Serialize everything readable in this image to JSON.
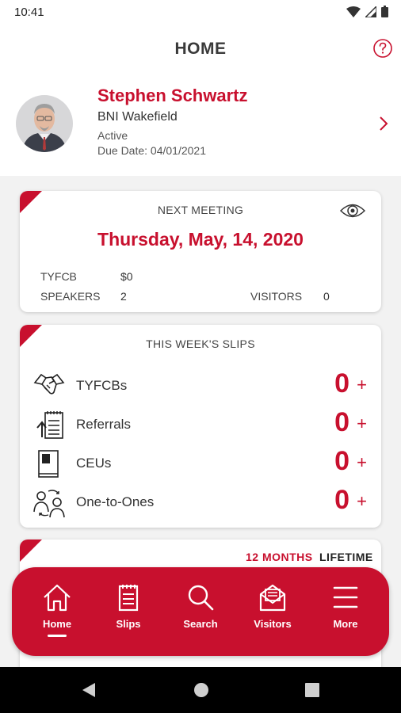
{
  "status_bar": {
    "time": "10:41"
  },
  "header": {
    "title": "HOME"
  },
  "profile": {
    "name": "Stephen Schwartz",
    "chapter": "BNI Wakefield",
    "status": "Active",
    "due_date": "Due Date: 04/01/2021"
  },
  "next_meeting": {
    "heading": "NEXT MEETING",
    "date": "Thursday, May, 14, 2020",
    "tyfcb_label": "TYFCB",
    "tyfcb_value": "$0",
    "speakers_label": "SPEAKERS",
    "speakers_value": "2",
    "visitors_label": "VISITORS",
    "visitors_value": "0"
  },
  "slips": {
    "heading": "THIS WEEK'S SLIPS",
    "items": [
      {
        "label": "TYFCBs",
        "count": "0",
        "plus": "+",
        "icon": "handshake-icon"
      },
      {
        "label": "Referrals",
        "count": "0",
        "plus": "+",
        "icon": "referral-list-icon"
      },
      {
        "label": "CEUs",
        "count": "0",
        "plus": "+",
        "icon": "book-icon"
      },
      {
        "label": "One-to-Ones",
        "count": "0",
        "plus": "+",
        "icon": "people-exchange-icon"
      }
    ]
  },
  "stats": {
    "tab_12_months": "12 MONTHS",
    "tab_lifetime": "LIFETIME"
  },
  "bottom_nav": [
    {
      "label": "Home",
      "icon": "home-icon",
      "active": true
    },
    {
      "label": "Slips",
      "icon": "notepad-icon"
    },
    {
      "label": "Search",
      "icon": "search-icon"
    },
    {
      "label": "Visitors",
      "icon": "envelope-icon"
    },
    {
      "label": "More",
      "icon": "menu-icon"
    }
  ],
  "colors": {
    "brand_red": "#c8102e",
    "background": "#f2f2f2",
    "card": "#ffffff"
  }
}
